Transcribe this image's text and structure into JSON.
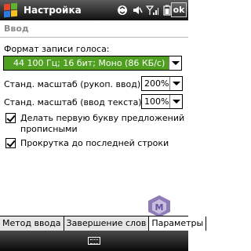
{
  "titlebar": {
    "title": "Настройка",
    "ok_label": "ok"
  },
  "section": {
    "header": "Ввод"
  },
  "voice_format": {
    "label": "Формат записи голоса:",
    "value": "44 100 Гц; 16 бит; Моно (86 КБ/с)",
    "accent_color": "#4fa020"
  },
  "handwriting_zoom": {
    "label": "Станд. масштаб (рукоп. ввод):",
    "value": "200%"
  },
  "typing_zoom": {
    "label": "Станд. масштаб (ввод текста):",
    "value": "100%"
  },
  "checkbox_capitalize": {
    "line1": "Делать первую букву предложений",
    "line2": "прописными",
    "checked": true
  },
  "checkbox_scroll": {
    "label": "Прокрутка до последней строки",
    "checked": true
  },
  "tabs": [
    {
      "label": "Метод ввода",
      "active": false
    },
    {
      "label": "Завершение слов",
      "active": false
    },
    {
      "label": "Параметры",
      "active": true
    }
  ],
  "icons": {
    "start": "windows-start-icon",
    "sync": "sync-icon",
    "sound": "speaker-icon",
    "signal": "signal-bars-icon",
    "battery": "battery-icon",
    "keyboard": "keyboard-icon"
  }
}
